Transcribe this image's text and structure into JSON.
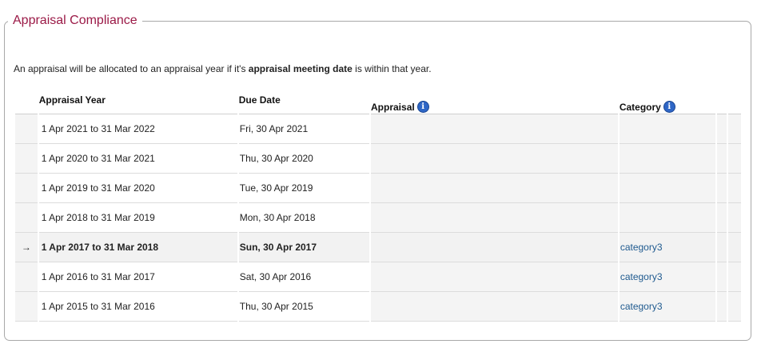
{
  "panel": {
    "title": "Appraisal Compliance",
    "intro_before": "An appraisal will be allocated to an appraisal year if it's ",
    "intro_bold": "appraisal meeting date",
    "intro_after": " is within that year."
  },
  "table": {
    "headers": {
      "year": "Appraisal Year",
      "due": "Due Date",
      "appraisal": "Appraisal",
      "category": "Category"
    },
    "info_icon": "i",
    "current_marker": "→",
    "rows": [
      {
        "year": "1 Apr 2021 to 31 Mar 2022",
        "due": "Fri, 30 Apr 2021",
        "category": ""
      },
      {
        "year": "1 Apr 2020 to 31 Mar 2021",
        "due": "Thu, 30 Apr 2020",
        "category": ""
      },
      {
        "year": "1 Apr 2019 to 31 Mar 2020",
        "due": "Tue, 30 Apr 2019",
        "category": ""
      },
      {
        "year": "1 Apr 2018 to 31 Mar 2019",
        "due": "Mon, 30 Apr 2018",
        "category": ""
      },
      {
        "year": "1 Apr 2017 to 31 Mar 2018",
        "due": "Sun, 30 Apr 2017",
        "category": "category3"
      },
      {
        "year": "1 Apr 2016 to 31 Mar 2017",
        "due": "Sat, 30 Apr 2016",
        "category": "category3"
      },
      {
        "year": "1 Apr 2015 to 31 Mar 2016",
        "due": "Thu, 30 Apr 2015",
        "category": "category3"
      }
    ]
  },
  "colors": {
    "title": "#9b1a47",
    "link": "#1f5a8f",
    "info_icon": "#2e66c6"
  }
}
